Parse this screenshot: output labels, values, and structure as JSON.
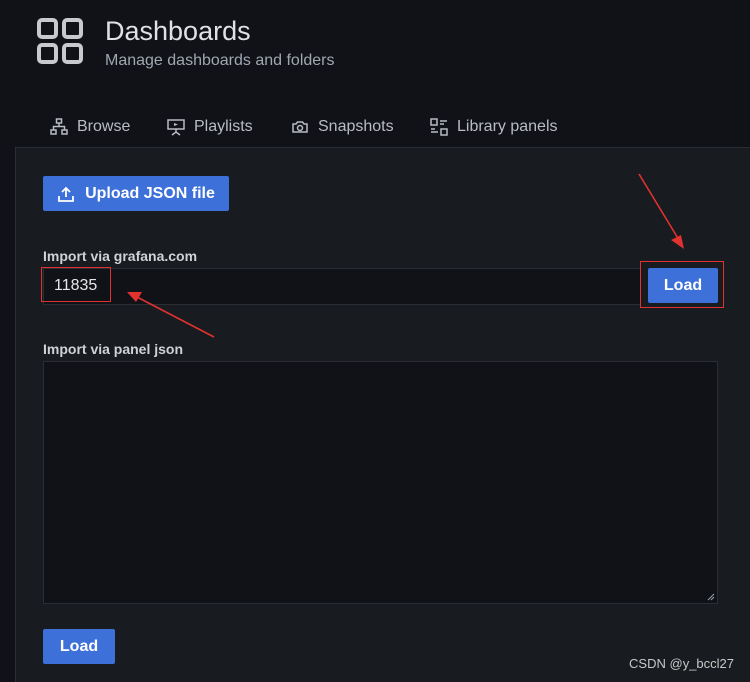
{
  "header": {
    "logo_icon": "dashboards-grid-icon",
    "title": "Dashboards",
    "subtitle": "Manage dashboards and folders"
  },
  "tabs": [
    {
      "label": "Browse",
      "icon": "sitemap-icon"
    },
    {
      "label": "Playlists",
      "icon": "presentation-icon"
    },
    {
      "label": "Snapshots",
      "icon": "camera-icon"
    },
    {
      "label": "Library panels",
      "icon": "library-panels-icon"
    }
  ],
  "import": {
    "upload_button": "Upload JSON file",
    "grafana_label": "Import via grafana.com",
    "grafana_value": "11835",
    "load_button": "Load",
    "panel_json_label": "Import via panel json",
    "panel_json_value": "",
    "bottom_load_button": "Load"
  },
  "watermark": "CSDN @y_bccl27",
  "colors": {
    "accent": "#3d71d9",
    "annotation": "#e0322f",
    "background": "#111217",
    "panel": "#181b1f"
  }
}
